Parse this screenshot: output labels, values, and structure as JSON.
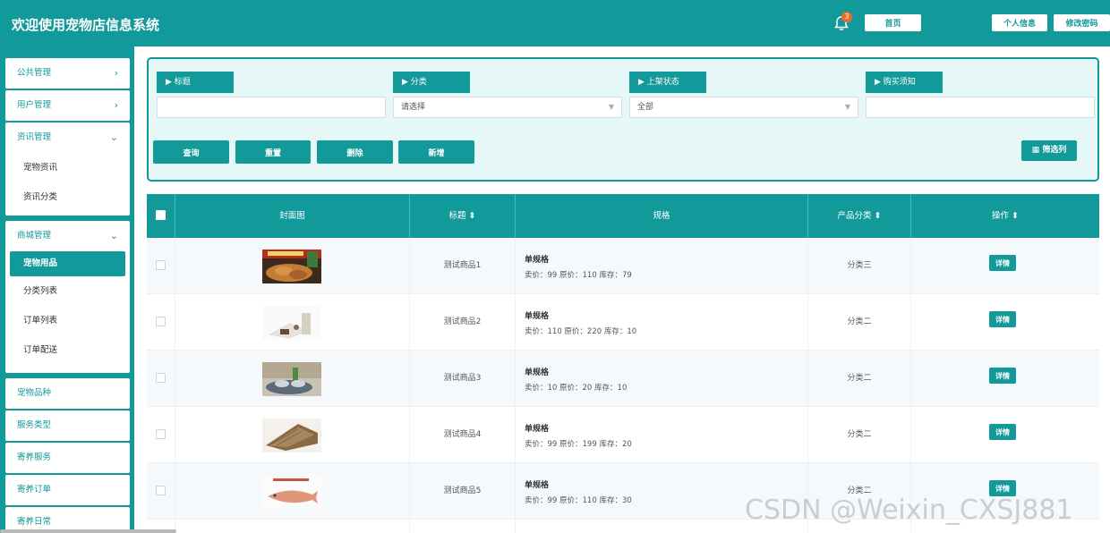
{
  "header": {
    "title": "欢迎使用宠物店信息系统",
    "notification_count": "3",
    "home_label": "首页",
    "profile_label": "个人信息",
    "password_label": "修改密码",
    "bell_icon": "bell-icon"
  },
  "sidebar": {
    "public": "公共管理",
    "users": "用户管理",
    "news": "资讯管理",
    "news_items": [
      "宠物资讯",
      "资讯分类"
    ],
    "shop": "商城管理",
    "shop_items": [
      "宠物用品",
      "分类列表",
      "订单列表",
      "订单配送"
    ],
    "others": [
      "宠物品种",
      "服务类型",
      "寄养服务",
      "寄养订单",
      "寄养日常"
    ]
  },
  "search": {
    "title_label": "▶ 标题",
    "category_label": "▶ 分类",
    "status_label": "▶ 上架状态",
    "notice_label": "▶ 购买须知",
    "category_placeholder": "请选择",
    "status_value": "全部",
    "buttons": {
      "query": "查询",
      "reset": "重置",
      "delete": "删除",
      "add": "新增"
    },
    "filter_columns": "筛选列"
  },
  "table": {
    "headers": {
      "cover": "封面图",
      "title": "标题",
      "spec": "规格",
      "category": "产品分类",
      "ops": "操作"
    },
    "detail_label": "详情",
    "rows": [
      {
        "title": "测试商品1",
        "spec_name": "单规格",
        "spec_info": "卖价：99  原价：110  库存：79",
        "category": "分类三"
      },
      {
        "title": "测试商品2",
        "spec_name": "单规格",
        "spec_info": "卖价：110  原价：220  库存：10",
        "category": "分类二"
      },
      {
        "title": "测试商品3",
        "spec_name": "单规格",
        "spec_info": "卖价：10  原价：20  库存：10",
        "category": "分类二"
      },
      {
        "title": "测试商品4",
        "spec_name": "单规格",
        "spec_info": "卖价：99  原价：199  库存：20",
        "category": "分类二"
      },
      {
        "title": "测试商品5",
        "spec_name": "单规格",
        "spec_info": "卖价：99  原价：110  库存：30",
        "category": "分类二"
      }
    ]
  },
  "watermark": "CSDN @Weixin_CXSJ881",
  "colors": {
    "primary": "#12999a",
    "panel_bg": "#e6f7f8",
    "badge": "#ee6d2a"
  }
}
